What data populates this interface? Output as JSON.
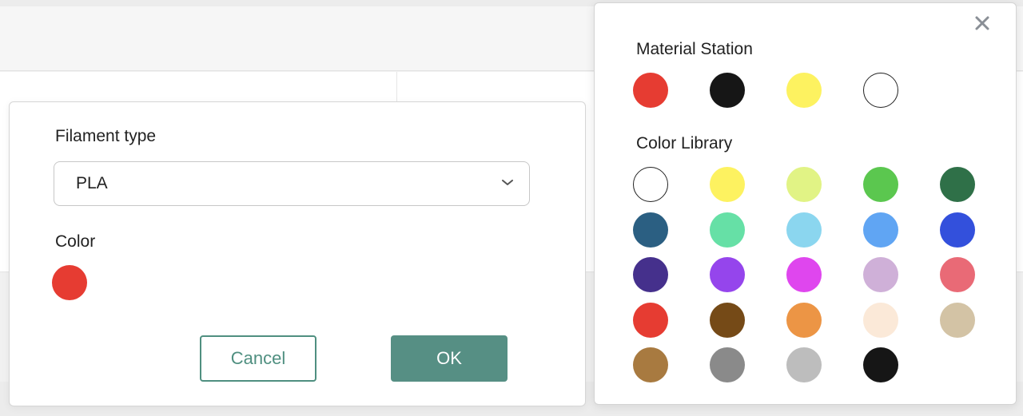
{
  "dialog": {
    "filament_label": "Filament type",
    "filament_value": "PLA",
    "color_label": "Color",
    "selected_color": "#e63c32",
    "cancel_label": "Cancel",
    "ok_label": "OK",
    "accent": "#568f84"
  },
  "picker": {
    "station_title": "Material Station",
    "station_colors": [
      "#e63c32",
      "#161616",
      "#fdf260",
      "#ffffff"
    ],
    "library_title": "Color Library",
    "library_colors": [
      "#ffffff",
      "#fdf260",
      "#e1f385",
      "#5bc74f",
      "#2f7048",
      "#2b5f82",
      "#66e0a6",
      "#8bd6ef",
      "#60a5f3",
      "#3350dc",
      "#45308c",
      "#9545ec",
      "#df46ee",
      "#cfb0d8",
      "#e96a76",
      "#e63c32",
      "#754a17",
      "#ec9545",
      "#fbe9d8",
      "#d3c3a5",
      "#a87a40",
      "#8a8a8a",
      "#bdbdbd",
      "#161616"
    ]
  },
  "icons": {
    "close": "close-icon",
    "chevron": "chevron-down-icon"
  }
}
